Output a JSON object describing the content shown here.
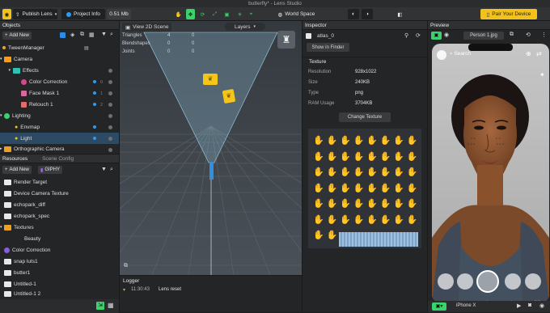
{
  "window_title": "butterfly* - Lens Studio",
  "toolbar": {
    "publish": "Publish Lens",
    "project_info": "Project Info",
    "size": "0.51 Mb",
    "space": "World Space",
    "pair": "Pair Your Device"
  },
  "objects": {
    "title": "Objects",
    "add_new": "Add New",
    "items": [
      {
        "label": "TweenManager",
        "count": ""
      },
      {
        "label": "Camera",
        "count": ""
      },
      {
        "label": "Effects",
        "count": ""
      },
      {
        "label": "Color Correction",
        "count": "0"
      },
      {
        "label": "Face Mask 1",
        "count": "1"
      },
      {
        "label": "Retouch 1",
        "count": "2"
      },
      {
        "label": "Lighting",
        "count": ""
      },
      {
        "label": "Envmap",
        "count": ""
      },
      {
        "label": "Light",
        "count": ""
      },
      {
        "label": "Orthographic Camera",
        "count": ""
      }
    ]
  },
  "resources": {
    "title": "Resources",
    "scene_config": "Scene Config",
    "add_new": "Add New",
    "giphy": "GIPHY",
    "items": [
      "Render Target",
      "Device Camera Texture",
      "echopark_diff",
      "echopark_spec",
      "Textures",
      "Beauty",
      "Color Correction",
      "snap luts1",
      "butter1",
      "Untitled-1",
      "Untitled-1 2"
    ]
  },
  "viewport": {
    "view_button": "View 2D Scene",
    "layers": "Layers",
    "stats": [
      {
        "label": "Triangles",
        "a": "4",
        "b": "0"
      },
      {
        "label": "Blendshapes",
        "a": "0",
        "b": "0"
      },
      {
        "label": "Joints",
        "a": "0",
        "b": "0"
      }
    ]
  },
  "logger": {
    "title": "Logger",
    "time": "11:30:43",
    "message": "Lens reset"
  },
  "inspector": {
    "title": "Inspector",
    "asset": "atlas_0",
    "show_in_finder": "Show in Finder",
    "texture_header": "Texture",
    "props": [
      {
        "k": "Resolution",
        "v": "928x1022"
      },
      {
        "k": "Size",
        "v": "240KB"
      },
      {
        "k": "Type",
        "v": "png"
      },
      {
        "k": "RAM Usage",
        "v": "3704KB"
      }
    ],
    "change_texture": "Change Texture"
  },
  "preview": {
    "title": "Preview",
    "person": "Person 1.jpg",
    "search": "Search",
    "device": "iPhone X"
  },
  "colors": {
    "accent": "#f2c21b",
    "selection": "#2c4a63",
    "panel": "#242527",
    "green": "#3ad36b"
  }
}
